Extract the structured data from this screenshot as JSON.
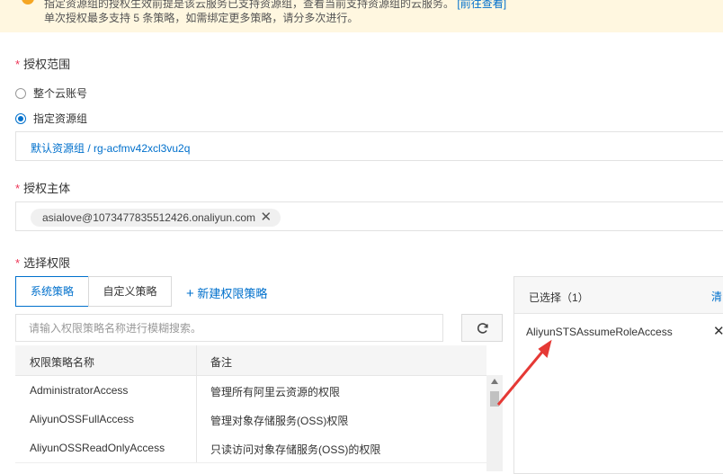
{
  "notice": {
    "line1_text": "指定资源组的授权生效前提是该云服务已支持资源组，查看当前支持资源组的云服务。",
    "line1_link": "[前往查看]",
    "line2_text": "单次授权最多支持 5 条策略，如需绑定更多策略，请分多次进行。"
  },
  "scope": {
    "label": "授权范围",
    "options": [
      "整个云账号",
      "指定资源组"
    ],
    "selected": "指定资源组",
    "resource_group": "默认资源组 / rg-acfmv42xcl3vu2q"
  },
  "principal": {
    "label": "授权主体",
    "tag": "asialove@1073477835512426.onaliyun.com"
  },
  "permissions": {
    "label": "选择权限",
    "tabs": [
      "系统策略",
      "自定义策略"
    ],
    "active_tab": "系统策略",
    "new_policy": "新建权限策略",
    "search_placeholder": "请输入权限策略名称进行模糊搜索。",
    "columns": [
      "权限策略名称",
      "备注"
    ],
    "rows": [
      {
        "name": "AdministratorAccess",
        "note": "管理所有阿里云资源的权限"
      },
      {
        "name": "AliyunOSSFullAccess",
        "note": "管理对象存储服务(OSS)权限"
      },
      {
        "name": "AliyunOSSReadOnlyAccess",
        "note": "只读访问对象存储服务(OSS)的权限"
      }
    ]
  },
  "selected_panel": {
    "title": "已选择（1）",
    "clear": "清",
    "items": [
      "AliyunSTSAssumeRoleAccess"
    ]
  },
  "icons": {
    "warning": "warning-icon",
    "refresh": "refresh-icon",
    "remove": "close-icon",
    "plus": "plus-icon"
  },
  "colors": {
    "primary": "#0070cc",
    "required": "#ee3355",
    "annotation_arrow": "#e53935"
  }
}
